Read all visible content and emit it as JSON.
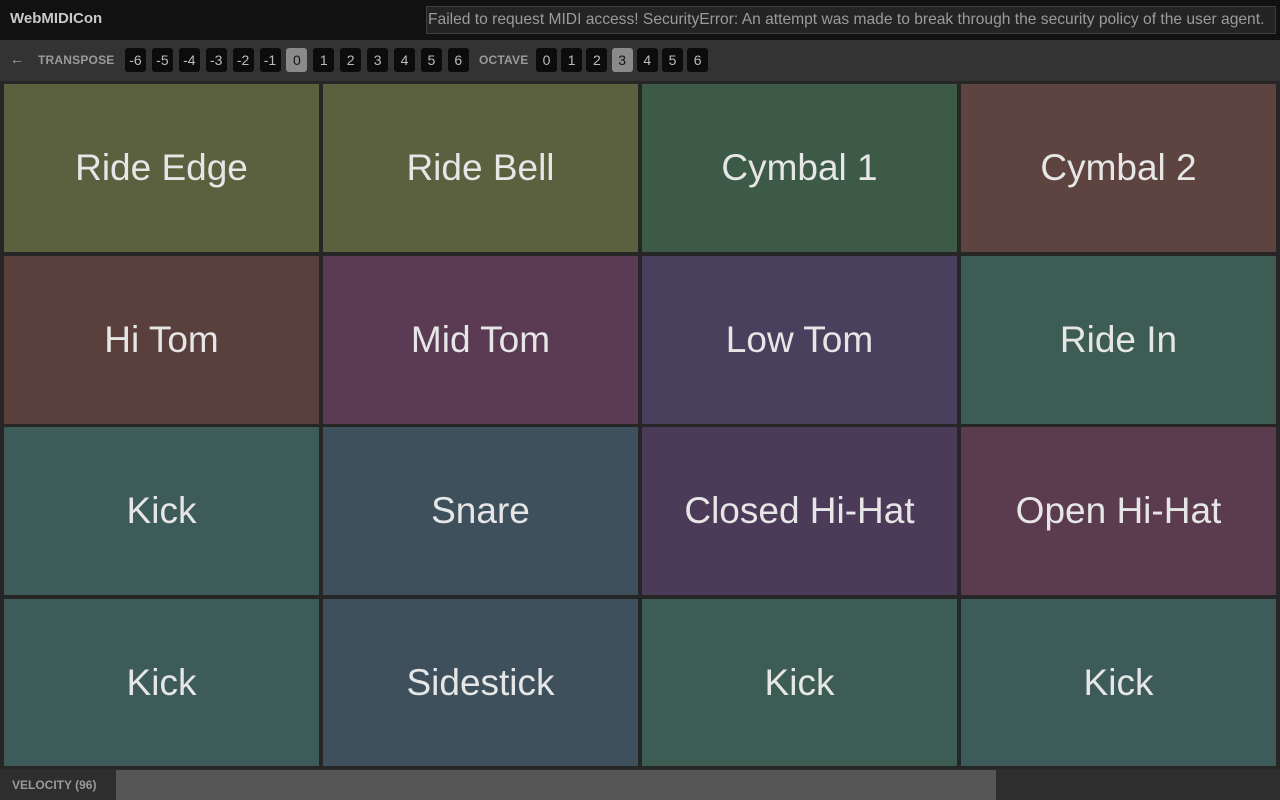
{
  "app": {
    "title": "WebMIDICon"
  },
  "error": {
    "message": "Failed to request MIDI access! SecurityError: An attempt was made to break through the security policy of the user agent."
  },
  "toolbar": {
    "back_symbol": "←",
    "transpose_label": "TRANSPOSE",
    "transpose_values": [
      "-6",
      "-5",
      "-4",
      "-3",
      "-2",
      "-1",
      "0",
      "1",
      "2",
      "3",
      "4",
      "5",
      "6"
    ],
    "transpose_selected": "0",
    "octave_label": "OCTAVE",
    "octave_values": [
      "0",
      "1",
      "2",
      "3",
      "4",
      "5",
      "6"
    ],
    "octave_selected": "3"
  },
  "pads": [
    {
      "label": "Ride Edge",
      "color": "#5b603f"
    },
    {
      "label": "Ride Bell",
      "color": "#5b603f"
    },
    {
      "label": "Cymbal 1",
      "color": "#3c5a45"
    },
    {
      "label": "Cymbal 2",
      "color": "#5d4440"
    },
    {
      "label": "Hi Tom",
      "color": "#5a403d"
    },
    {
      "label": "Mid Tom",
      "color": "#5b3b54"
    },
    {
      "label": "Low Tom",
      "color": "#48405c"
    },
    {
      "label": "Ride In",
      "color": "#3d5c54"
    },
    {
      "label": "Kick",
      "color": "#3d5c59"
    },
    {
      "label": "Snare",
      "color": "#3e505c"
    },
    {
      "label": "Closed Hi-Hat",
      "color": "#4b3b59"
    },
    {
      "label": "Open Hi-Hat",
      "color": "#5b3b4e"
    },
    {
      "label": "Kick",
      "color": "#3d5c59"
    },
    {
      "label": "Sidestick",
      "color": "#3e505c"
    },
    {
      "label": "Kick",
      "color": "#3d5c54"
    },
    {
      "label": "Kick",
      "color": "#3d5c59"
    }
  ],
  "velocity": {
    "label": "VELOCITY (96)",
    "value": 96
  }
}
